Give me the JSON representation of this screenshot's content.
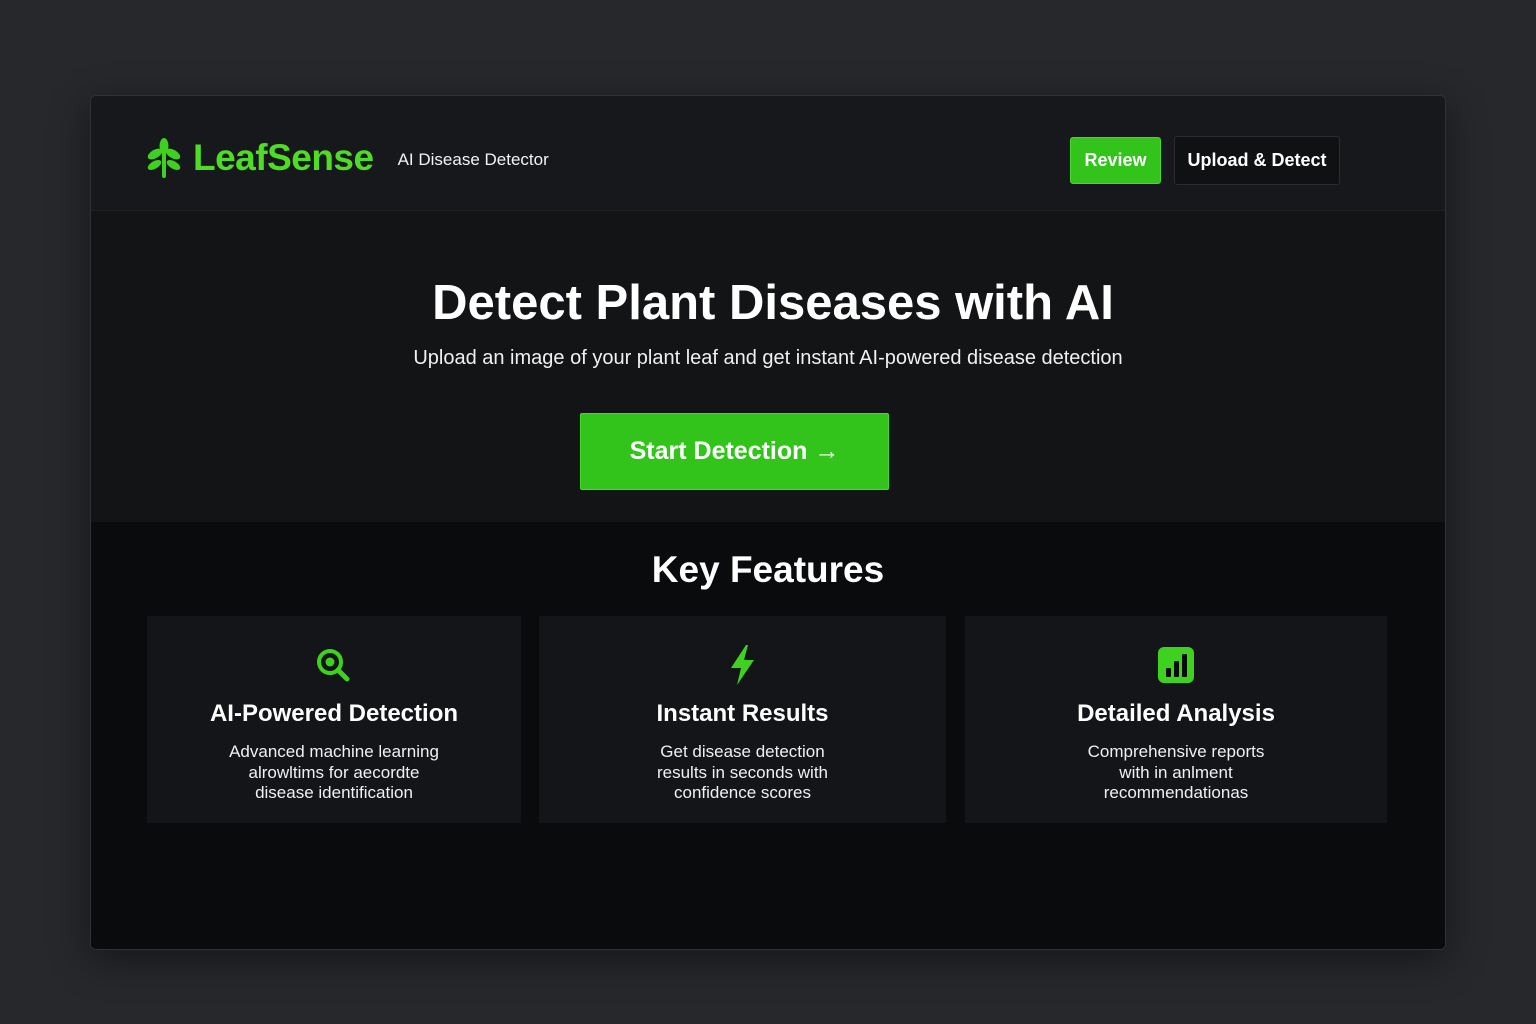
{
  "brand": {
    "name": "LeafSense",
    "tagline": "AI Disease Detector",
    "accent_color": "#33c41c",
    "icon": "leaf-icon"
  },
  "nav": {
    "review_label": "Review",
    "upload_label": "Upload & Detect"
  },
  "hero": {
    "title": "Detect Plant Diseases with AI",
    "subtitle": "Upload an image of your plant leaf and get instant AI-powered disease detection",
    "cta_label": "Start Detection →"
  },
  "features": {
    "heading": "Key Features",
    "items": [
      {
        "icon": "search-icon",
        "title": "AI-Powered Detection",
        "lines": [
          "Advanced machine learning",
          "alrowltims for aecordte",
          "disease identification"
        ]
      },
      {
        "icon": "lightning-icon",
        "title": "Instant Results",
        "lines": [
          "Get disease detection",
          "results in seconds with",
          "confidence scores"
        ]
      },
      {
        "icon": "bar-chart-icon",
        "title": "Detailed Analysis",
        "lines": [
          "Comprehensive reports",
          "with in anlment",
          "recommendationas"
        ]
      }
    ]
  }
}
